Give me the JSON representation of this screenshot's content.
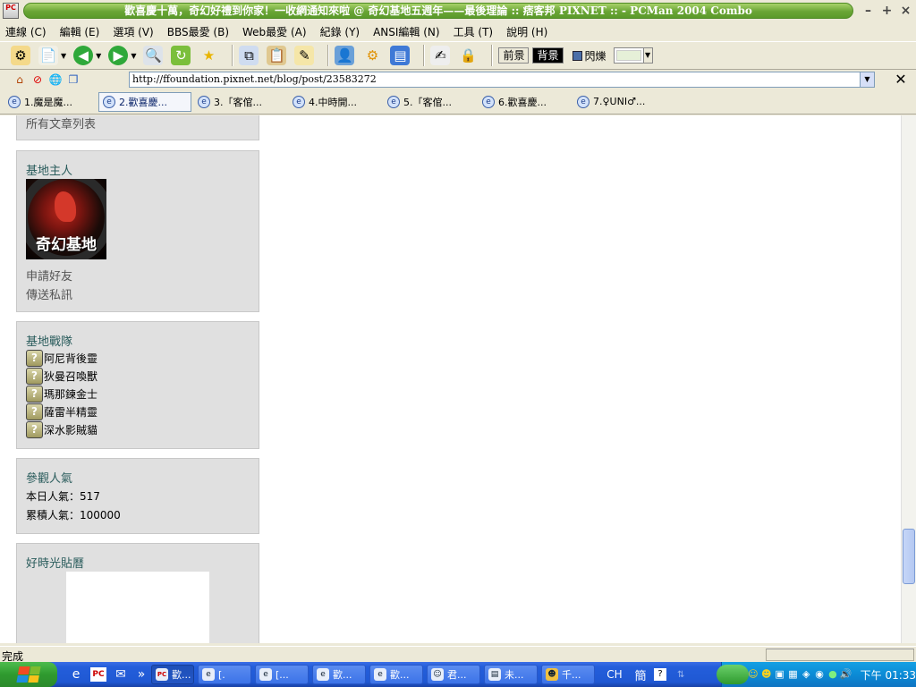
{
  "window": {
    "title": "歡喜慶十萬，奇幻好禮到你家！一收網通知來啦 @ 奇幻基地五週年——最後理論 :: 痞客邦 PIXNET :: - PCMan 2004 Combo",
    "logo_text": "PC"
  },
  "menu": [
    "連線 (C)",
    "編輯 (E)",
    "選項 (V)",
    "BBS最愛 (B)",
    "Web最愛 (A)",
    "紀錄 (Y)",
    "ANSI編輯 (N)",
    "工具 (T)",
    "說明 (H)"
  ],
  "toolbar": {
    "fg_label": "前景",
    "bg_label": "背景",
    "blink_label": "閃爍"
  },
  "address": {
    "url": "http://ffoundation.pixnet.net/blog/post/23583272"
  },
  "tabs": [
    {
      "label": "1.魔是魔...",
      "active": false
    },
    {
      "label": "2.歡喜慶...",
      "active": true
    },
    {
      "label": "3.「客倌...",
      "active": false
    },
    {
      "label": "4.中時開...",
      "active": false
    },
    {
      "label": "5.「客倌...",
      "active": false
    },
    {
      "label": "6.歡喜慶...",
      "active": false
    },
    {
      "label": "7.♀UNI♂...",
      "active": false
    }
  ],
  "sidebar": {
    "archive_link": "所有文章列表",
    "owner": {
      "title": "基地主人",
      "avatar_caption": "奇幻基地",
      "friend_link": "申請好友",
      "message_link": "傳送私訊"
    },
    "squad": {
      "title": "基地戰隊",
      "members": [
        "阿尼背後靈",
        "狄曼召喚獸",
        "瑪那鍊金士",
        "薩雷半精靈",
        "深水影賊貓"
      ]
    },
    "visitors": {
      "title": "參觀人氣",
      "today": "本日人氣：517",
      "total": "累積人氣：100000"
    },
    "calendar": {
      "title": "好時光貼曆"
    }
  },
  "status": {
    "text": "完成"
  },
  "taskbar": {
    "buttons": [
      "歡...",
      "[.",
      "[...",
      "歡...",
      "歡...",
      "君...",
      "未...",
      "千..."
    ],
    "lang": "CH",
    "ime": "簡",
    "clock": "下午 01:33"
  },
  "colors": {
    "title_green": "#6aa535",
    "sidebar_bg": "#e0e0e0",
    "sidebar_title": "#2a5c5c",
    "taskbar_blue": "#245edb",
    "tray_blue": "#0b8bd6"
  }
}
